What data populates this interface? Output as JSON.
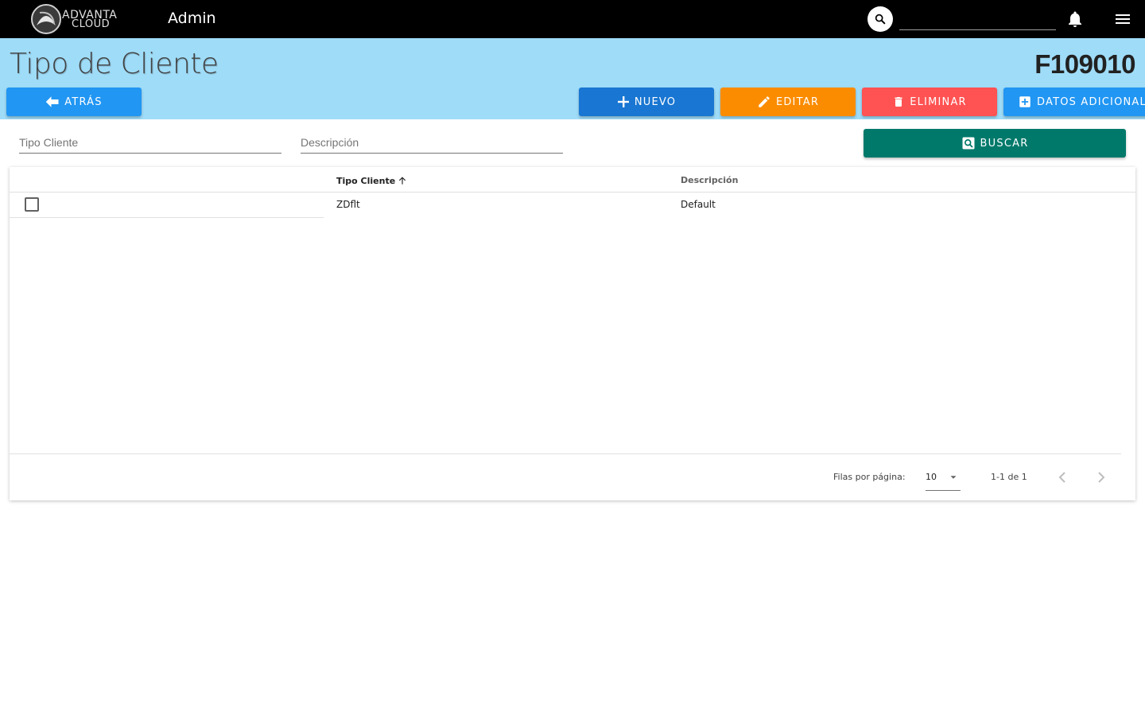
{
  "topbar": {
    "logo_line1": "ADVANTA",
    "logo_line2": "CLOUD",
    "module": "Admin",
    "search_value": ""
  },
  "header": {
    "title": "Tipo de Cliente",
    "code": "F109010"
  },
  "actions": {
    "back": "ATRÁS",
    "new": "NUEVO",
    "edit": "EDITAR",
    "delete": "ELIMINAR",
    "extra": "DATOS ADICIONALES"
  },
  "filters": {
    "tipo_placeholder": "Tipo Cliente",
    "desc_placeholder": "Descripción",
    "search_label": "BUSCAR"
  },
  "table": {
    "columns": [
      "Tipo Cliente",
      "Descripción"
    ],
    "rows": [
      {
        "tipo": "ZDflt",
        "descripcion": "Default"
      }
    ],
    "rows_per_page_label": "Filas por página:",
    "rows_per_page": "10",
    "range": "1-1 de 1"
  },
  "colors": {
    "band": "#9fdcf8",
    "back": "#2196f3",
    "new": "#1976d2",
    "edit": "#fb8c00",
    "delete": "#ff5252",
    "search": "#00796b"
  }
}
